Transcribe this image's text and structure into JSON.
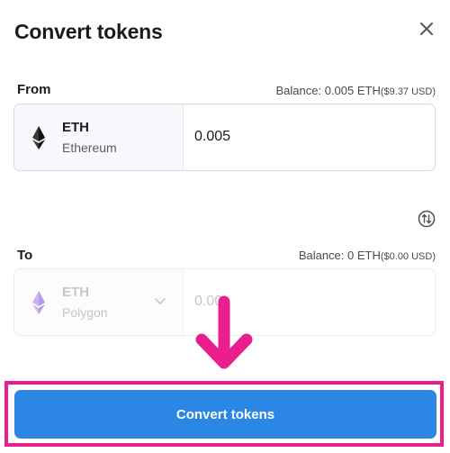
{
  "dialog": {
    "title": "Convert tokens",
    "close_icon": "close-icon"
  },
  "from": {
    "label": "From",
    "balance": "Balance: 0.005 ETH",
    "balance_usd": "($9.37 USD)",
    "token_symbol": "ETH",
    "token_network": "Ethereum",
    "amount": "0.005"
  },
  "swap_icon": "swap-vertical-icon",
  "to": {
    "label": "To",
    "balance": "Balance: 0 ETH",
    "balance_usd": "($0.00 USD)",
    "token_symbol": "ETH",
    "token_network": "Polygon",
    "amount": "0.00"
  },
  "annotation": {
    "arrow_color": "#ea1e8c",
    "highlight_color": "#ea1e8c"
  },
  "convert_button": {
    "label": "Convert tokens",
    "color": "#2c86e4"
  }
}
